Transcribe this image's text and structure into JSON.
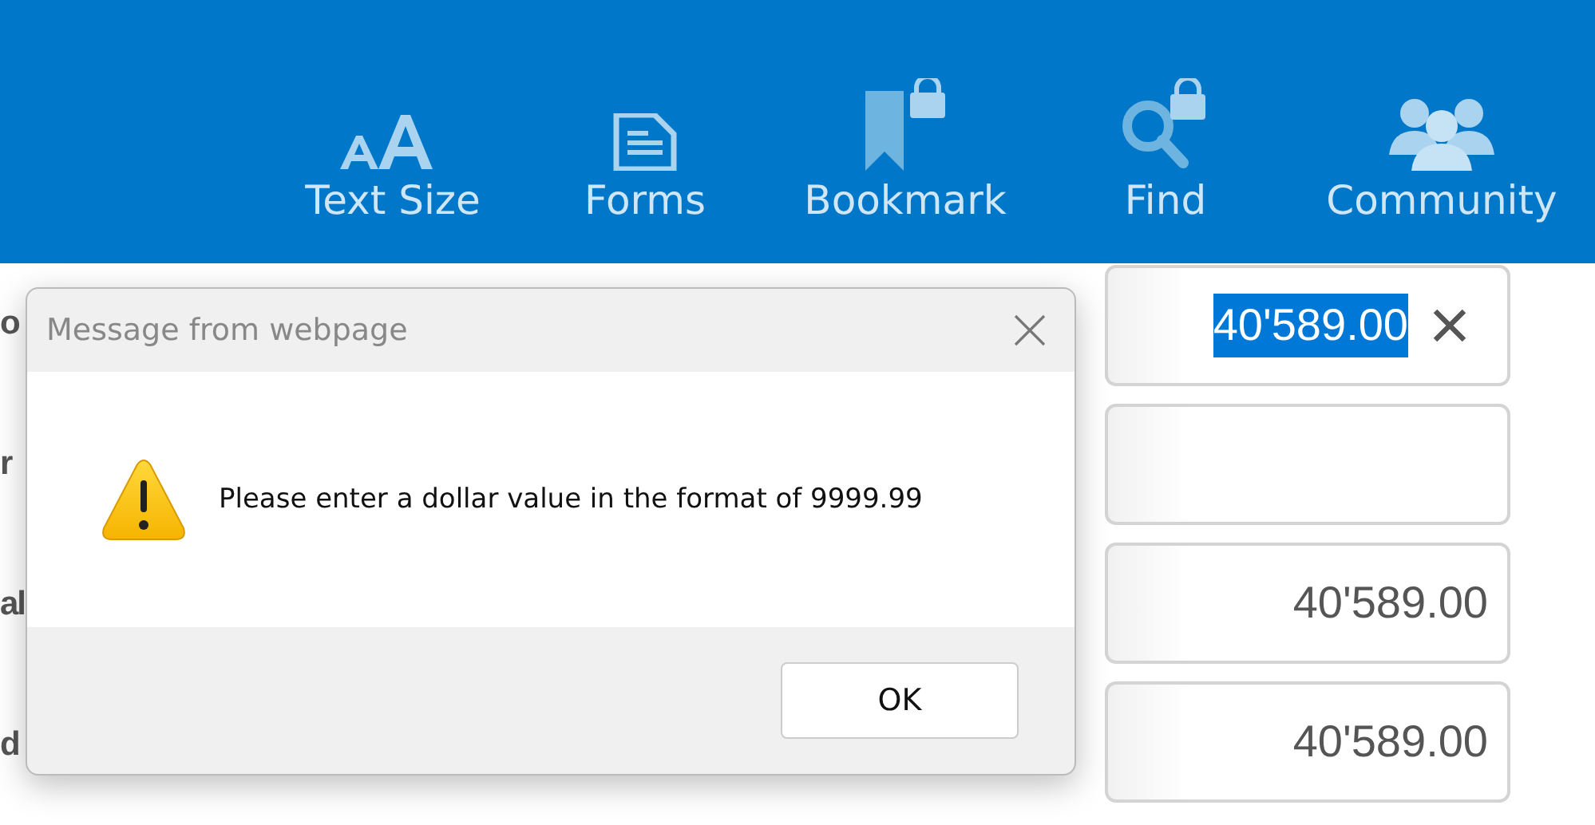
{
  "toolbar": {
    "items": [
      {
        "label": "Text Size"
      },
      {
        "label": "Forms"
      },
      {
        "label": "Bookmark"
      },
      {
        "label": "Find"
      },
      {
        "label": "Community"
      }
    ]
  },
  "form": {
    "labels": [
      "o",
      "r",
      "al",
      "d"
    ],
    "fields": [
      {
        "value": "40'589.00",
        "focused": true
      },
      {
        "focused": false
      },
      {
        "value": "40'589.00",
        "focused": false
      },
      {
        "value": "40'589.00",
        "focused": false
      }
    ]
  },
  "dialog": {
    "title": "Message from webpage",
    "message": "Please enter a dollar value in the format of 9999.99",
    "buttons": [
      "OK"
    ]
  }
}
